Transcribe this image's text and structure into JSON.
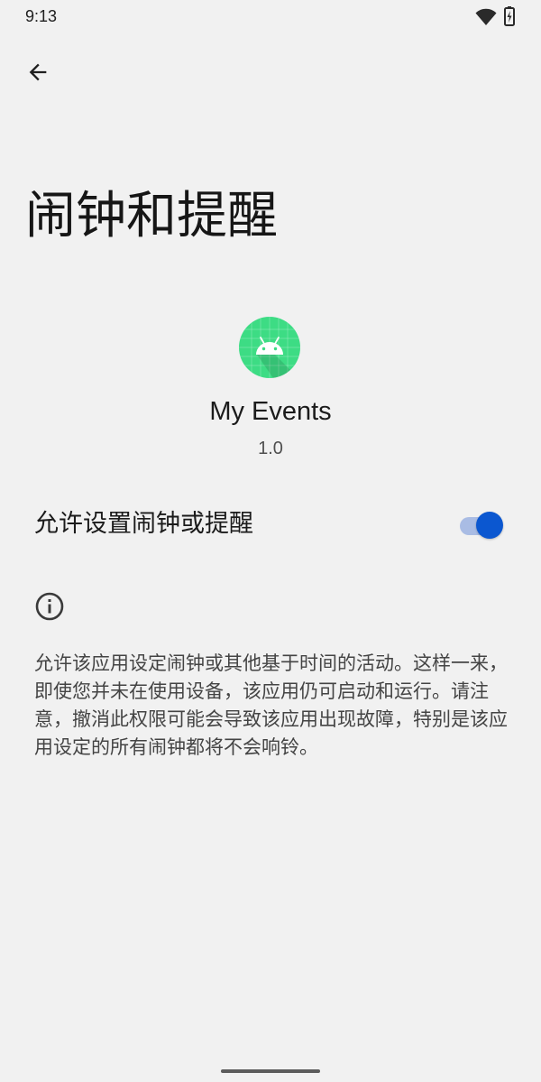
{
  "status_bar": {
    "time": "9:13",
    "icons": [
      "wifi-icon",
      "battery-icon"
    ]
  },
  "header": {
    "back_icon": "arrow-back-icon",
    "title": "闹钟和提醒"
  },
  "app": {
    "icon": "android-app-icon",
    "icon_color": "#3ddc84",
    "name": "My Events",
    "version": "1.0"
  },
  "permission": {
    "label": "允许设置闹钟或提醒",
    "enabled": true,
    "accent_color": "#0b57d0"
  },
  "info": {
    "icon": "info-icon",
    "description": "允许该应用设定闹钟或其他基于时间的活动。这样一来，即使您并未在使用设备，该应用仍可启动和运行。请注意，撤消此权限可能会导致该应用出现故障，特别是该应用设定的所有闹钟都将不会响铃。"
  }
}
